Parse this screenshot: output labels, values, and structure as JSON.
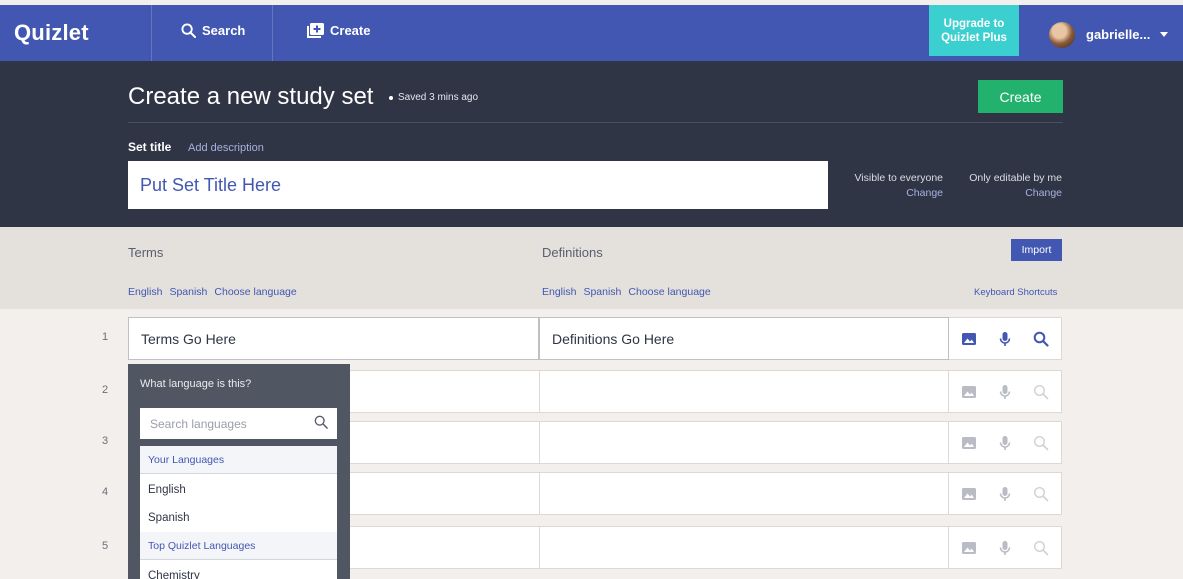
{
  "nav": {
    "logo": "Quizlet",
    "search_label": "Search",
    "create_label": "Create",
    "upgrade_line1": "Upgrade to",
    "upgrade_line2": "Quizlet Plus",
    "username": "gabrielle..."
  },
  "header": {
    "title": "Create a new study set",
    "saved": "Saved 3 mins ago",
    "create_button": "Create",
    "set_title_label": "Set title",
    "add_description": "Add description",
    "title_placeholder": "Put Set Title Here",
    "visibility_label": "Visible to everyone",
    "visibility_change": "Change",
    "editable_label": "Only editable by me",
    "editable_change": "Change"
  },
  "columns": {
    "terms_header": "Terms",
    "definitions_header": "Definitions",
    "import_button": "Import",
    "keyboard_shortcuts": "Keyboard Shortcuts",
    "terms_langs": [
      "English",
      "Spanish",
      "Choose language"
    ],
    "definitions_langs": [
      "English",
      "Spanish",
      "Choose language"
    ]
  },
  "rows": [
    {
      "num": "1",
      "term": "Terms Go Here",
      "definition": "Definitions Go Here"
    },
    {
      "num": "2",
      "term": "",
      "definition": ""
    },
    {
      "num": "3",
      "term": "",
      "definition": ""
    },
    {
      "num": "4",
      "term": "",
      "definition": ""
    },
    {
      "num": "5",
      "term": "",
      "definition": ""
    }
  ],
  "language_popup": {
    "title": "What language is this?",
    "search_placeholder": "Search languages",
    "your_languages": "Your Languages",
    "lang1": "English",
    "lang2": "Spanish",
    "top_languages": "Top Quizlet Languages",
    "lang3": "Chemistry"
  },
  "colors": {
    "nav_bg": "#4257b2",
    "header_bg": "#303545",
    "accent_green": "#23b26d",
    "upgrade_teal": "#3ccfcf"
  },
  "icons": [
    "search-icon",
    "create-plus-icon",
    "chevron-down-icon",
    "image-icon",
    "microphone-icon",
    "magnifier-icon"
  ]
}
